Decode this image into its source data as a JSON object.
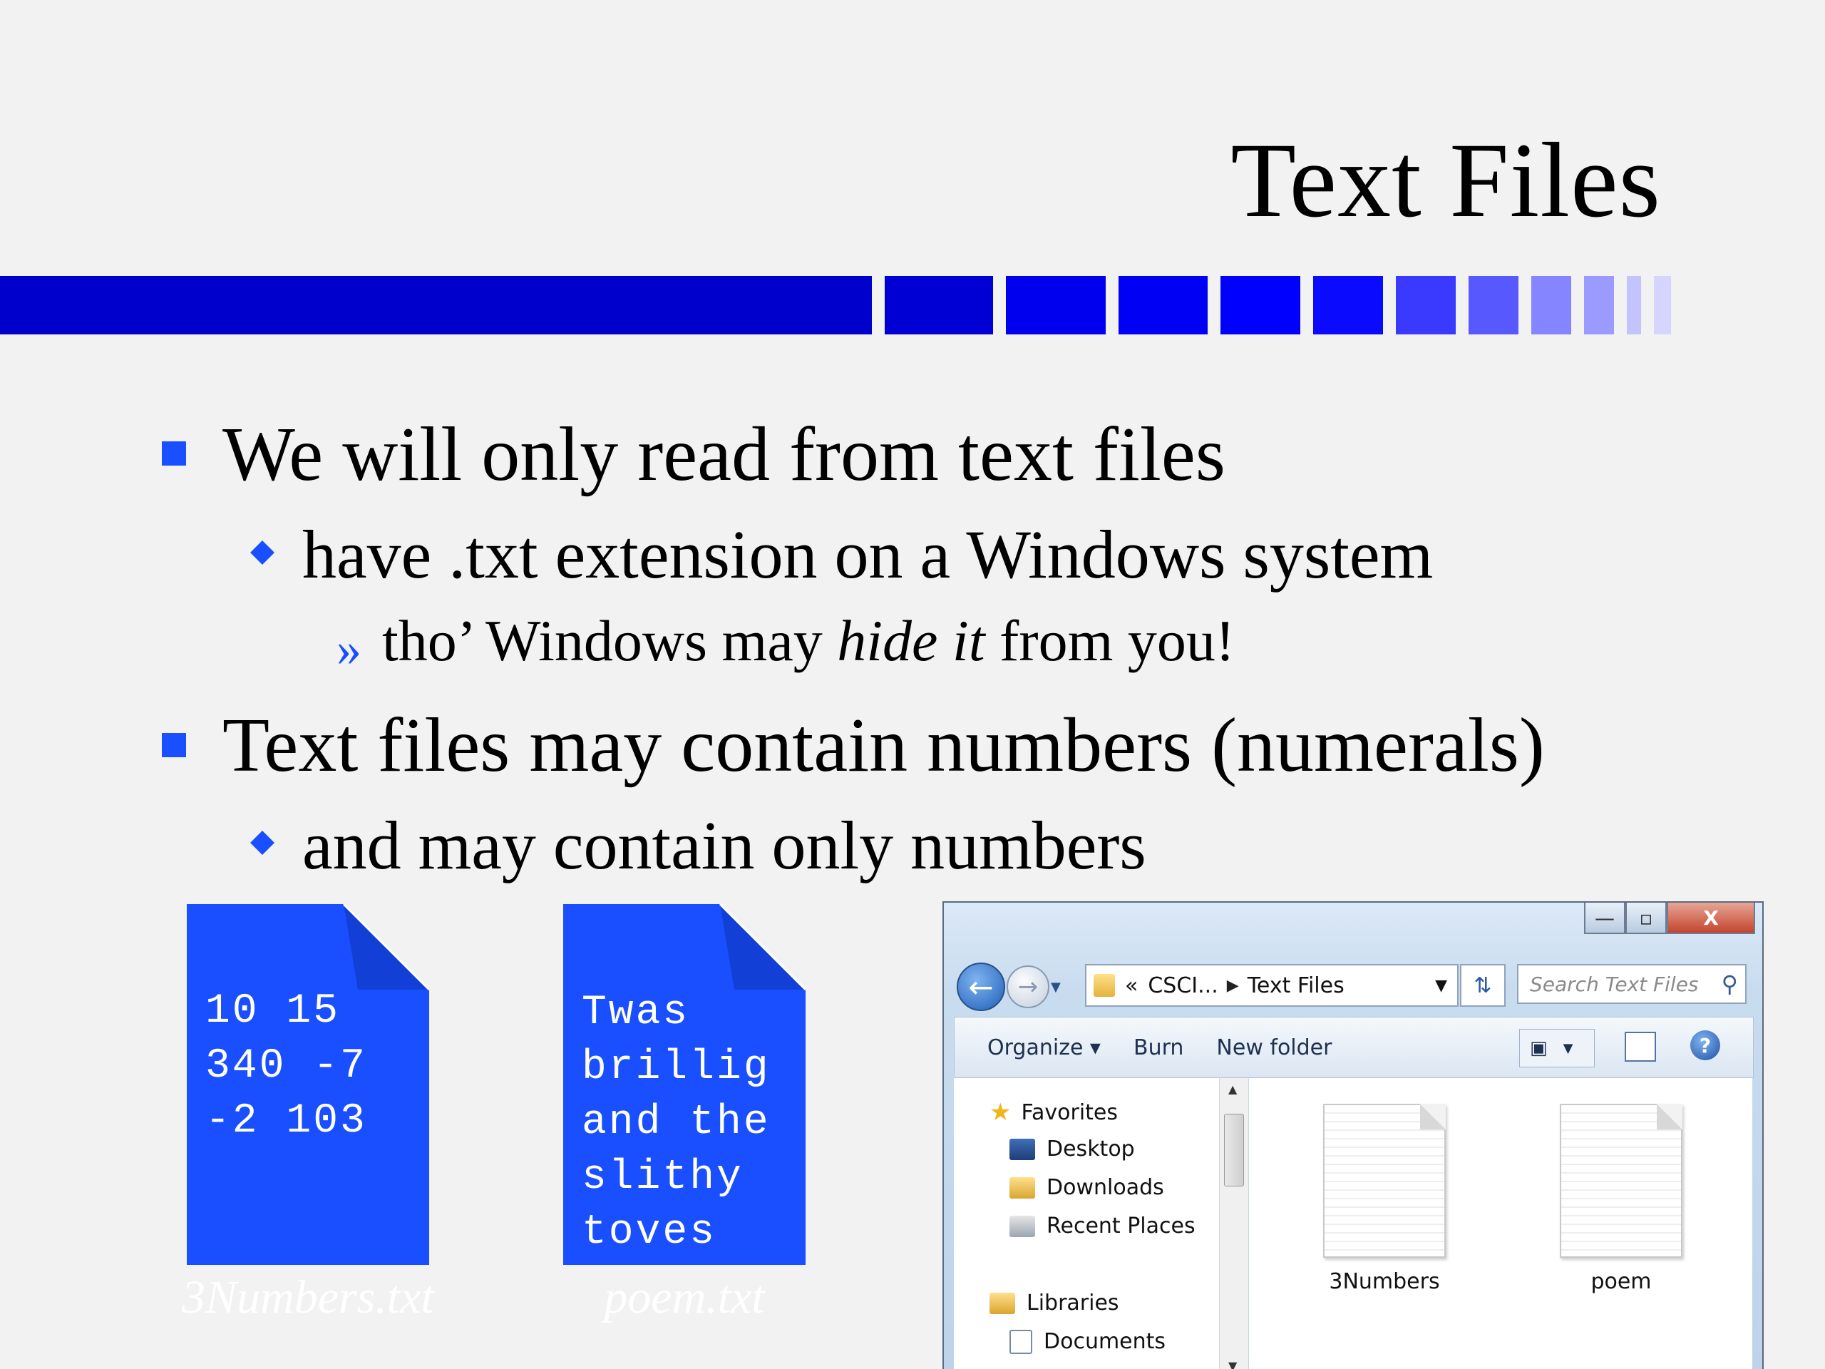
{
  "slide": {
    "title": "Text Files",
    "accent_color": "#0000dd",
    "bullets": {
      "b1": "We will only read from text files",
      "b1_1": "have .txt extension on a Windows system",
      "b1_1_1_pre": "tho’ Windows may ",
      "b1_1_1_em": "hide it",
      "b1_1_1_post": " from you!",
      "b2": "Text files may contain numbers (numerals)",
      "b2_1": "and may contain only numbers"
    },
    "marker_raquo": "»"
  },
  "docs": [
    {
      "lines": "10 15\n340 -7\n-2 103",
      "caption": "3Numbers.txt",
      "color": "#1a4fff"
    },
    {
      "lines": "Twas\nbrillig\nand the\nslithy\ntoves",
      "caption": "poem.txt",
      "color": "#1a4fff"
    }
  ],
  "explorer": {
    "controls": {
      "minimize": "—",
      "maximize": "▫",
      "close": "X"
    },
    "address": {
      "prefix": "«",
      "crumb1": "CSCI...",
      "crumb2": "Text Files"
    },
    "search_placeholder": "Search Text Files",
    "toolbar": {
      "organize": "Organize ▾",
      "burn": "Burn",
      "new_folder": "New folder"
    },
    "nav": {
      "favorites": "Favorites",
      "desktop": "Desktop",
      "downloads": "Downloads",
      "recent": "Recent Places",
      "libraries": "Libraries",
      "documents": "Documents"
    },
    "files": [
      "3Numbers",
      "poem"
    ]
  }
}
